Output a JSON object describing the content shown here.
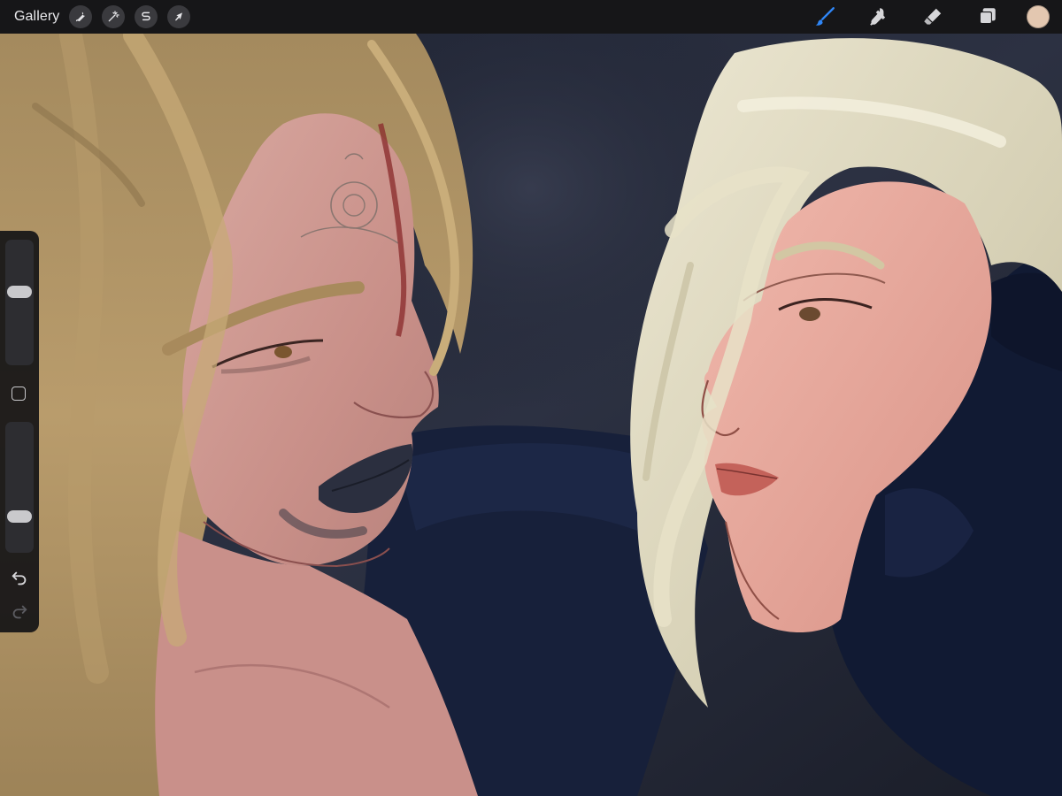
{
  "topbar": {
    "gallery_label": "Gallery",
    "actions": [
      {
        "name": "actions-wrench-icon"
      },
      {
        "name": "adjustments-magic-wand-icon"
      },
      {
        "name": "selection-s-icon"
      },
      {
        "name": "transform-arrow-icon"
      }
    ],
    "tools": [
      {
        "name": "brush-icon",
        "active": true
      },
      {
        "name": "smudge-icon",
        "active": false
      },
      {
        "name": "eraser-icon",
        "active": false
      },
      {
        "name": "layers-icon",
        "active": false
      }
    ],
    "current_color": "#e3c7b0"
  },
  "sidebar": {
    "brush_size_fraction": 0.6,
    "opacity_fraction": 0.25,
    "icons": {
      "modify": "square-icon",
      "undo": "undo-icon",
      "redo": "redo-icon"
    }
  },
  "colors": {
    "accent_blue": "#2f86f6",
    "toolbar_bg": "#161618",
    "icon_gray": "#d6d6d9"
  }
}
